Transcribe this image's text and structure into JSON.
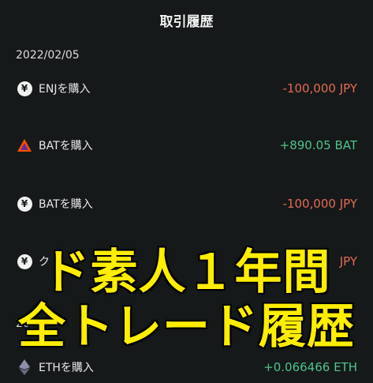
{
  "header": {
    "title": "取引履歴"
  },
  "groups": [
    {
      "date": "2022/02/05",
      "items": [
        {
          "icon": "yen-icon",
          "label": "ENJを購入",
          "amount": "-100,000 JPY",
          "direction": "negative"
        },
        {
          "icon": "bat-icon",
          "label": "BATを購入",
          "amount": "+890.05 BAT",
          "direction": "positive"
        },
        {
          "icon": "yen-icon",
          "label": "BATを購入",
          "amount": "-100,000 JPY",
          "direction": "negative"
        },
        {
          "icon": "yen-icon",
          "label": "ク",
          "amount": "JPY",
          "direction": "negative"
        }
      ]
    },
    {
      "date_partial_left": "20",
      "date_partial_right": "15",
      "items": [
        {
          "icon": "eth-icon",
          "label": "ETHを購入",
          "amount": "+0.066466 ETH",
          "direction": "positive"
        }
      ]
    }
  ],
  "overlay": {
    "line1": "ド素人１年間",
    "line2": "全トレード履歴"
  },
  "colors": {
    "background": "#16191a",
    "negative": "#e36a55",
    "positive": "#4fc38a",
    "overlay_text": "#ffee00"
  }
}
